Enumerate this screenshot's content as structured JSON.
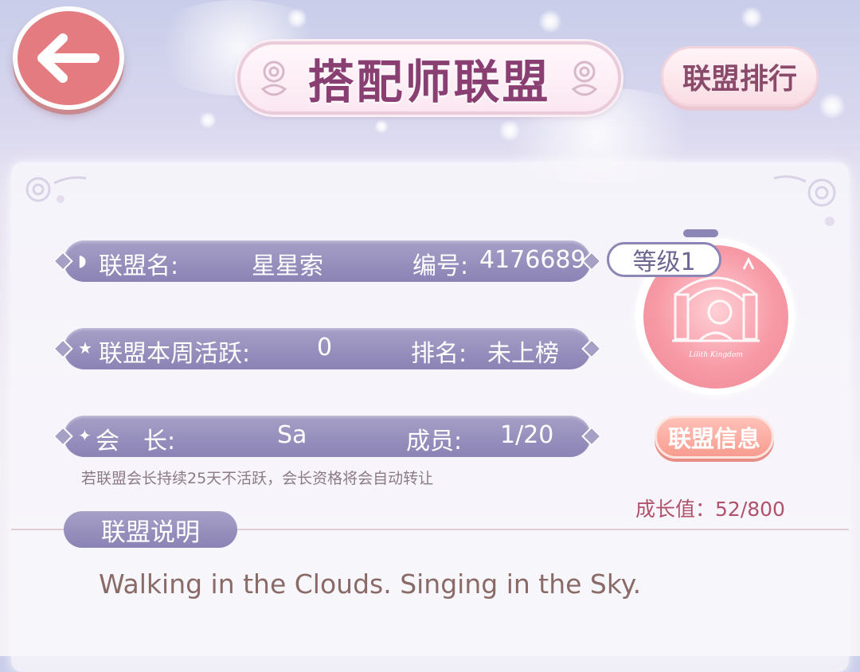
{
  "header": {
    "title": "搭配师联盟",
    "rank_button": "联盟排行"
  },
  "alliance": {
    "name_label": "联盟名:",
    "name_value": "星星索",
    "id_label": "编号:",
    "id_value": "4176689",
    "activity_label": "联盟本周活跃:",
    "activity_value": "0",
    "rank_label": "排名:",
    "rank_value": "未上榜",
    "leader_label": "会　长:",
    "leader_value": "Sa",
    "members_label": "成员:",
    "members_value": "1/20",
    "notice": "若联盟会长持续25天不活跃，会长资格将会自动转让",
    "level": "等级1",
    "info_button": "联盟信息",
    "growth_label": "成长值：",
    "growth_value": "52/800",
    "emblem_text": "Lilith Kingdom"
  },
  "description": {
    "tab_label": "联盟说明",
    "text": "Walking in the Clouds.  Singing in the Sky."
  },
  "icons": {
    "back": "arrow-left-icon",
    "name_row": "book-icon",
    "activity_row": "star-icon",
    "leader_row": "sparkle-icon"
  },
  "colors": {
    "accent_pink": "#e47b80",
    "bar_lavender": "#8a83b5",
    "title": "#8a3f73",
    "growth": "#b0526a"
  }
}
